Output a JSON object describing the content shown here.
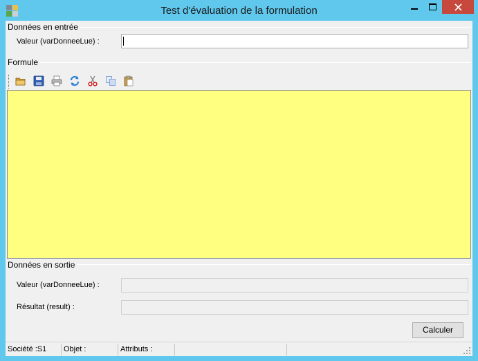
{
  "window": {
    "title": "Test d'évaluation de la formulation"
  },
  "input_group": {
    "title": "Données en entrée",
    "value_label": "Valeur (varDonneeLue) :",
    "value": ""
  },
  "formula_group": {
    "title": "Formule",
    "toolbar": [
      {
        "name": "open-icon"
      },
      {
        "name": "save-icon"
      },
      {
        "name": "print-icon"
      },
      {
        "name": "refresh-icon"
      },
      {
        "name": "cut-icon"
      },
      {
        "name": "copy-icon"
      },
      {
        "name": "paste-icon"
      }
    ],
    "editor_text": "",
    "editor_color": "#ffff80"
  },
  "output_group": {
    "title": "Données en sortie",
    "value_label": "Valeur (varDonneeLue) :",
    "value": "",
    "result_label": "Résultat (result) :",
    "result": ""
  },
  "actions": {
    "calc_label": "Calculer"
  },
  "statusbar": {
    "company": "Société :S1",
    "object": "Objet :",
    "attributes": "Attributs :"
  },
  "colors": {
    "titlebar": "#5fc8ec",
    "close_button": "#c7493d"
  }
}
